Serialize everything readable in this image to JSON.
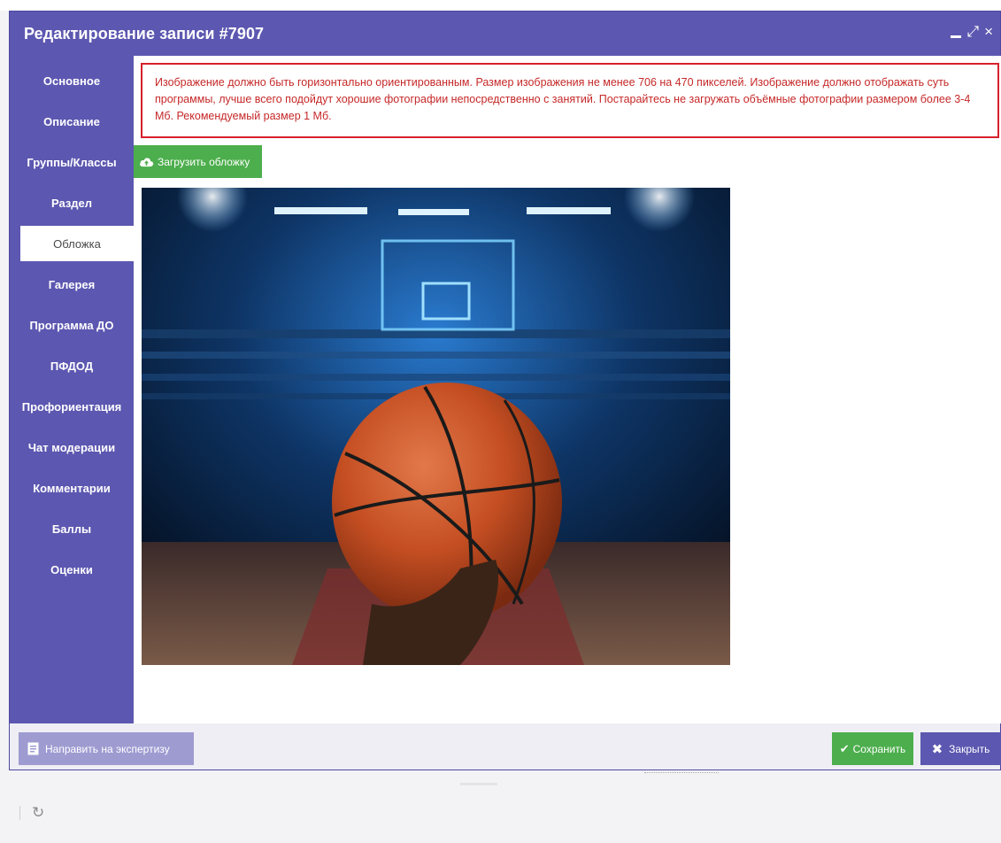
{
  "dialog": {
    "title": "Редактирование записи #7907",
    "controls": {
      "minimize": "minimize-icon",
      "maximize": "⤢",
      "close": "×"
    }
  },
  "sidebar": {
    "items": [
      {
        "label": "Основное",
        "active": false
      },
      {
        "label": "Описание",
        "active": false
      },
      {
        "label": "Группы/Классы",
        "active": false
      },
      {
        "label": "Раздел",
        "active": false
      },
      {
        "label": "Обложка",
        "active": true
      },
      {
        "label": "Галерея",
        "active": false
      },
      {
        "label": "Программа ДО",
        "active": false
      },
      {
        "label": "ПФДОД",
        "active": false
      },
      {
        "label": "Профориентация",
        "active": false
      },
      {
        "label": "Чат модерации",
        "active": false
      },
      {
        "label": "Комментарии",
        "active": false
      },
      {
        "label": "Баллы",
        "active": false
      },
      {
        "label": "Оценки",
        "active": false
      }
    ]
  },
  "content": {
    "alert_text": "Изображение должно быть горизонтально ориентированным. Размер изображения не менее 706 на 470 пикселей. Изображение должно отображать суть программы, лучше всего подойдут хорошие фотографии непосредственно с занятий. Постарайтесь не загружать объёмные фотографии размером более 3-4 Мб. Рекомендуемый размер 1 Мб.",
    "upload_label": "Загрузить обложку",
    "upload_icon": "cloud-upload-icon",
    "cover_image": "basketball-arena-photo"
  },
  "footer": {
    "expert_label": "Направить на экспертизу",
    "expert_icon": "document-icon",
    "save_label": "Сохранить",
    "save_icon": "✔",
    "close_label": "Закрыть",
    "close_icon": "✖"
  },
  "page": {
    "refresh_icon": "↻"
  },
  "colors": {
    "accent": "#5c57b0",
    "success": "#4cae4c",
    "danger": "#d6212b",
    "muted_button": "#9e9bd1"
  }
}
